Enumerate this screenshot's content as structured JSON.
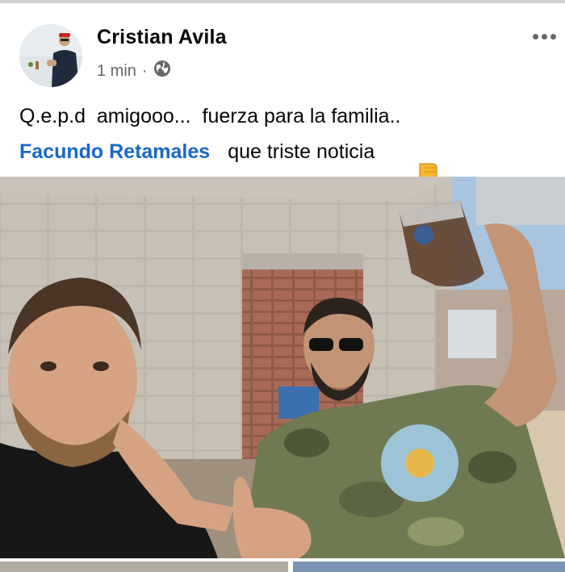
{
  "post": {
    "author": "Cristian Avila",
    "time": "1 min",
    "separator": "·",
    "audience_icon": "globe-icon",
    "more_icon": "more-horizontal-icon",
    "message_line1": "Q.e.p.d  amigooo...  fuerza para la familia..",
    "mention": "Facundo Retamales",
    "message_line2": "que triste noticia",
    "emoji": "thumbs-down-emoji"
  },
  "colors": {
    "mention": "#1868c9",
    "text": "#050505",
    "secondary": "#65676b"
  }
}
